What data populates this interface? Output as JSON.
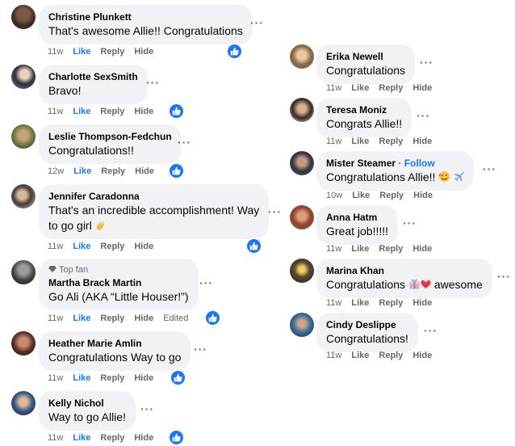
{
  "left_column": [
    {
      "name": "Christine Plunkett",
      "text": "That's awesome Allie!! Congratulations",
      "time": "11w",
      "like": "Like",
      "reply": "Reply",
      "hide": "Hide",
      "reaction": "like"
    },
    {
      "name": "Charlotte SexSmith",
      "text": "Bravo!",
      "time": "11w",
      "like": "Like",
      "reply": "Reply",
      "hide": "Hide",
      "reaction": "like"
    },
    {
      "name": "Leslie Thompson-Fedchun",
      "text": "Congratulations!!",
      "time": "12w",
      "like": "Like",
      "reply": "Reply",
      "hide": "Hide",
      "reaction": "like"
    },
    {
      "name": "Jennifer Caradonna",
      "text_line1": "That's an incredible accomplishment! Way",
      "text_line2": "to go girl",
      "emoji": "clapping-hands",
      "time": "11w",
      "like": "Like",
      "reply": "Reply",
      "hide": "Hide",
      "reaction": "like"
    },
    {
      "badge": "Top fan",
      "name": "Martha Brack Martin",
      "text": "Go Ali (AKA “Little Houser!”)",
      "time": "11w",
      "like": "Like",
      "reply": "Reply",
      "hide": "Hide",
      "edited": "Edited",
      "reaction": "like"
    },
    {
      "name": "Heather Marie Amlin",
      "text": "Congratulations Way to go",
      "time": "11w",
      "like": "Like",
      "reply": "Reply",
      "hide": "Hide",
      "reaction": "like"
    },
    {
      "name": "Kelly Nichol",
      "text": "Way to go Allie!",
      "time": "11w",
      "like": "Like",
      "reply": "Reply",
      "hide": "Hide",
      "reaction": "like"
    }
  ],
  "right_column": [
    {
      "name": "Erika Newell",
      "text": "Congratulations",
      "time": "11w",
      "like": "Like",
      "reply": "Reply",
      "hide": "Hide"
    },
    {
      "name": "Teresa Moniz",
      "text": "Congrats Allie!!",
      "time": "11w",
      "like": "Like",
      "reply": "Reply",
      "hide": "Hide"
    },
    {
      "name": "Mister Steamer",
      "follow": " · Follow",
      "text": "Congratulations Allie!!",
      "emojis": [
        "smiling-face-with-hearts",
        "airplane"
      ],
      "time": "10w",
      "like": "Like",
      "reply": "Reply",
      "hide": "Hide"
    },
    {
      "name": "Anna Hatm",
      "text": "Great job!!!!!",
      "time": "11w",
      "like": "Like",
      "reply": "Reply",
      "hide": "Hide"
    },
    {
      "name": "Marina Khan",
      "text_before": "Congratulations",
      "text_after": "awesome",
      "emojis": [
        "wrapped-gift",
        "heart-sparkle"
      ],
      "time": "11w",
      "like": "Like",
      "reply": "Reply",
      "hide": "Hide"
    },
    {
      "name": "Cindy Deslippe",
      "text": "Congratulations!",
      "time": "11w",
      "like": "Like",
      "reply": "Reply",
      "hide": "Hide"
    }
  ],
  "more_glyph": "···",
  "colors": {
    "accent": "#1877f2",
    "bubble": "#f0f2f5",
    "meta": "#65676b",
    "text": "#050505"
  }
}
